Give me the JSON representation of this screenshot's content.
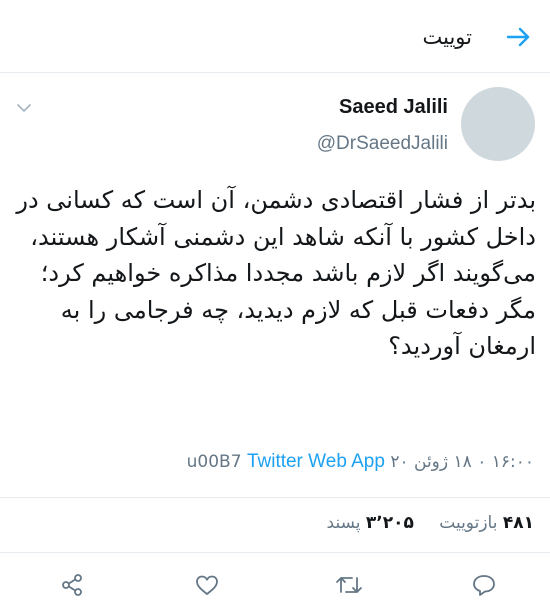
{
  "header": {
    "title": "توییت",
    "back_icon": "arrow-right-icon",
    "accent_color": "#1da1f2"
  },
  "author": {
    "name": "Saeed Jalili",
    "handle": "@DrSaeedJalili"
  },
  "tweet": {
    "text": "بدتر از فشار اقتصادی دشمن، آن است که کسانی در داخل کشور با آنکه شاهد این دشمنی آشکار هستند، می‌گویند اگر لازم باشد مجددا مذاکره خواهیم کرد؛ مگر دفعات قبل که لازم دیدید، چه فرجامی را به ارمغان آوردید؟",
    "time": "۱۶:۰۰ ۰ ۱۸ ژوئن ۲۰ u00B7",
    "source": "Twitter Web App"
  },
  "stats": {
    "retweets_count": "۴۸۱",
    "retweets_label": "بازتوییت",
    "likes_count": "۳٬۲۰۵",
    "likes_label": "پسند"
  },
  "actions": [
    "reply-icon",
    "retweet-icon",
    "like-icon",
    "share-icon"
  ]
}
